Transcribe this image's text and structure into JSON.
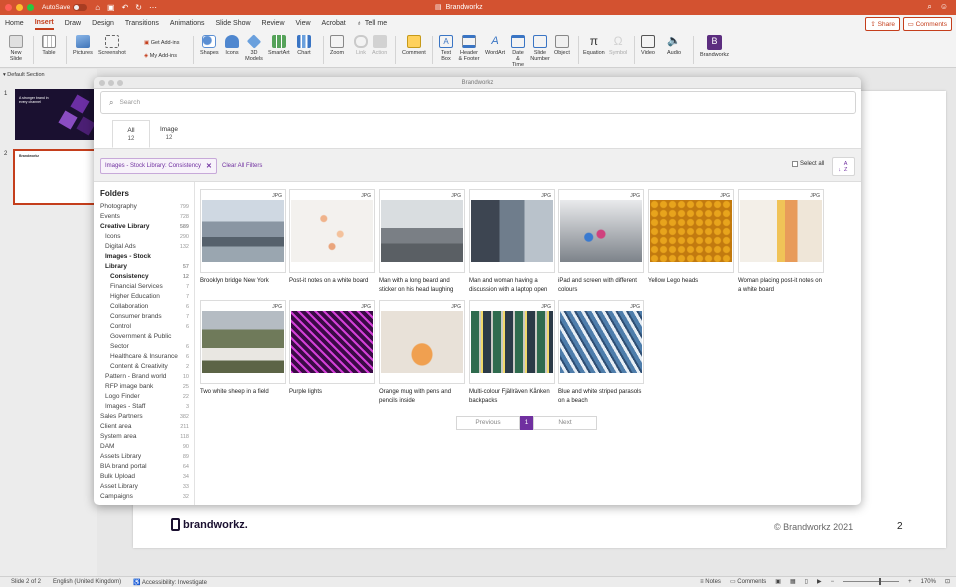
{
  "titlebar": {
    "autosave_label": "AutoSave",
    "toggle_label": "OFF",
    "doc_title": "Brandworkz",
    "colors": {
      "bar": "#d35230",
      "accent": "#c43e1c"
    }
  },
  "ribbon_tabs": [
    "Home",
    "Insert",
    "Draw",
    "Design",
    "Transitions",
    "Animations",
    "Slide Show",
    "Review",
    "View",
    "Acrobat"
  ],
  "active_tab": "Insert",
  "tell_me": "Tell me",
  "share_label": "Share",
  "comments_label": "Comments",
  "ribbon": {
    "new_slide": "New Slide",
    "table": "Table",
    "pictures": "Pictures",
    "screenshot": "Screenshot",
    "get_addins": "Get Add-ins",
    "my_addins": "My Add-ins",
    "shapes": "Shapes",
    "icons": "Icons",
    "models": "3D Models",
    "smartart": "SmartArt",
    "chart": "Chart",
    "zoom": "Zoom",
    "link": "Link",
    "action": "Action",
    "comment": "Comment",
    "textbox": "Text Box",
    "header_footer": "Header & Footer",
    "wordart": "WordArt",
    "date_time": "Date & Time",
    "slide_number": "Slide Number",
    "object": "Object",
    "equation": "Equation",
    "symbol": "Symbol",
    "video": "Video",
    "audio": "Audio",
    "brandworkz": "Brandworkz"
  },
  "leftpane": {
    "section": "Default Section",
    "slide1_num": "1",
    "slide2_num": "2",
    "slide1_text": "A stronger brand in every channel",
    "slide2_text": "Brandworkz"
  },
  "slide": {
    "logo": "brandworkz.",
    "copyright": "© Brandworkz 2021",
    "page": "2"
  },
  "statusbar": {
    "slide_of": "Slide 2 of 2",
    "language": "English (United Kingdom)",
    "accessibility": "Accessibility: Investigate",
    "notes": "Notes",
    "comments": "Comments",
    "zoom": "170%"
  },
  "dialog": {
    "title": "Brandworkz",
    "search_placeholder": "Search",
    "tabs": [
      {
        "label": "All",
        "count": "12"
      },
      {
        "label": "Image",
        "count": "12"
      }
    ],
    "filter_chip": "Images - Stock Library: Consistency",
    "clear_all": "Clear All Filters",
    "select_all": "Select all",
    "sort_label": "A Z",
    "folders_title": "Folders",
    "folders": [
      {
        "name": "Photography",
        "count": "799",
        "indent": 0,
        "bold": false
      },
      {
        "name": "Events",
        "count": "728",
        "indent": 0,
        "bold": false
      },
      {
        "name": "Creative Library",
        "count": "589",
        "indent": 0,
        "bold": true
      },
      {
        "name": "Icons",
        "count": "290",
        "indent": 1,
        "bold": false
      },
      {
        "name": "Digital Ads",
        "count": "132",
        "indent": 1,
        "bold": false
      },
      {
        "name": "Images - Stock",
        "count": "",
        "indent": 1,
        "bold": true
      },
      {
        "name": "Library",
        "count": "57",
        "indent": 1,
        "bold": true
      },
      {
        "name": "Consistency",
        "count": "12",
        "indent": 2,
        "bold": true
      },
      {
        "name": "Financial Services",
        "count": "7",
        "indent": 2,
        "bold": false
      },
      {
        "name": "Higher Education",
        "count": "7",
        "indent": 2,
        "bold": false
      },
      {
        "name": "Collaboration",
        "count": "6",
        "indent": 2,
        "bold": false
      },
      {
        "name": "Consumer brands",
        "count": "7",
        "indent": 2,
        "bold": false
      },
      {
        "name": "Control",
        "count": "6",
        "indent": 2,
        "bold": false
      },
      {
        "name": "Government & Public",
        "count": "",
        "indent": 2,
        "bold": false
      },
      {
        "name": "Sector",
        "count": "6",
        "indent": 2,
        "bold": false
      },
      {
        "name": "Healthcare & Insurance",
        "count": "6",
        "indent": 2,
        "bold": false
      },
      {
        "name": "Content & Creativity",
        "count": "2",
        "indent": 2,
        "bold": false
      },
      {
        "name": "Pattern - Brand world",
        "count": "10",
        "indent": 1,
        "bold": false
      },
      {
        "name": "RFP image bank",
        "count": "25",
        "indent": 1,
        "bold": false
      },
      {
        "name": "Logo Finder",
        "count": "22",
        "indent": 1,
        "bold": false
      },
      {
        "name": "Images - Staff",
        "count": "3",
        "indent": 1,
        "bold": false
      },
      {
        "name": "Sales Partners",
        "count": "382",
        "indent": 0,
        "bold": false
      },
      {
        "name": "Client area",
        "count": "211",
        "indent": 0,
        "bold": false
      },
      {
        "name": "System area",
        "count": "118",
        "indent": 0,
        "bold": false
      },
      {
        "name": "DAM",
        "count": "90",
        "indent": 0,
        "bold": false
      },
      {
        "name": "Assets Library",
        "count": "89",
        "indent": 0,
        "bold": false
      },
      {
        "name": "BIA brand portal",
        "count": "64",
        "indent": 0,
        "bold": false
      },
      {
        "name": "Bulk Upload",
        "count": "34",
        "indent": 0,
        "bold": false
      },
      {
        "name": "Asset Library",
        "count": "33",
        "indent": 0,
        "bold": false
      },
      {
        "name": "Campaigns",
        "count": "32",
        "indent": 0,
        "bold": false
      }
    ],
    "assets": [
      {
        "badge": "JPG",
        "caption": "Brooklyn bridge New York",
        "img": "bridge"
      },
      {
        "badge": "JPG",
        "caption": "Post-it notes on a white board",
        "img": "postit"
      },
      {
        "badge": "JPG",
        "caption": "Man with a long beard and sticker on his head laughing",
        "img": "beard"
      },
      {
        "badge": "JPG",
        "caption": "Man and woman having a discussion with a laptop open",
        "img": "laptop"
      },
      {
        "badge": "JPG",
        "caption": "iPad and screen with different colours",
        "img": "ipad"
      },
      {
        "badge": "JPG",
        "caption": "Yellow Lego heads",
        "img": "lego"
      },
      {
        "badge": "JPG",
        "caption": "Woman placing post-it notes on a white board",
        "img": "woman"
      },
      {
        "badge": "JPG",
        "caption": "Two white sheep in a field",
        "img": "sheep"
      },
      {
        "badge": "JPG",
        "caption": "Purple lights",
        "img": "purple"
      },
      {
        "badge": "JPG",
        "caption": "Orange mug with pens and pencils inside",
        "img": "mug"
      },
      {
        "badge": "JPG",
        "caption": "Multi-colour Fjällräven Kånken backpacks",
        "img": "backpacks"
      },
      {
        "badge": "JPG",
        "caption": "Blue and white striped parasols on a beach",
        "img": "parasols"
      }
    ],
    "pager": {
      "previous": "Previous",
      "current": "1",
      "next": "Next"
    }
  }
}
